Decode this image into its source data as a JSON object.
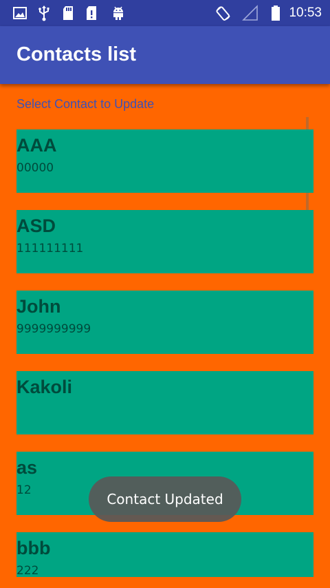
{
  "status_bar": {
    "time": "10:53",
    "left_icons": [
      "image-icon",
      "usb-icon",
      "sd-card-icon",
      "sd-card-alert-icon",
      "android-icon"
    ],
    "right_icons": [
      "screen-rotation-icon",
      "signal-icon",
      "battery-icon"
    ]
  },
  "app_bar": {
    "title": "Contacts list",
    "color": "#3f51b5"
  },
  "content": {
    "instruction": "Select Contact to Update",
    "background": "#ff6600",
    "card_color": "#00a583"
  },
  "contacts": [
    {
      "name": "AAA",
      "phone": "00000"
    },
    {
      "name": "ASD",
      "phone": "111111111"
    },
    {
      "name": "John",
      "phone": "9999999999"
    },
    {
      "name": "Kakoli",
      "phone": ""
    },
    {
      "name": "as",
      "phone": "12"
    },
    {
      "name": "bbb",
      "phone": "222"
    }
  ],
  "toast": {
    "message": "Contact Updated"
  }
}
